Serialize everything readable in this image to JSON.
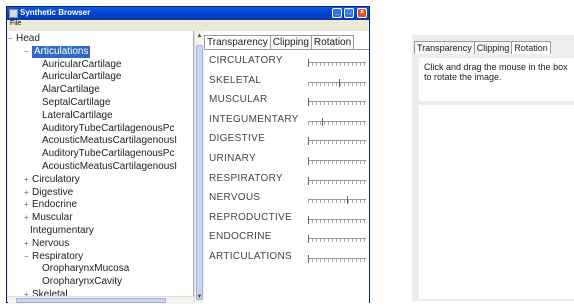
{
  "window": {
    "title": "Synthetic Browser",
    "menu": {
      "file": "File"
    }
  },
  "tree": {
    "nodes": [
      {
        "label": "Head",
        "expander": "−",
        "level": 0
      },
      {
        "label": "Articulations",
        "expander": "−",
        "level": 1,
        "selected": true
      },
      {
        "label": "AuricularCartilage",
        "level": 2
      },
      {
        "label": "AuricularCartilage",
        "level": 2
      },
      {
        "label": "AlarCartilage",
        "level": 2
      },
      {
        "label": "SeptalCartilage",
        "level": 2
      },
      {
        "label": "LateralCartilage",
        "level": 2
      },
      {
        "label": "AuditoryTubeCartilagenousPc",
        "level": 2
      },
      {
        "label": "AcousticMeatusCartilagenousI",
        "level": 2
      },
      {
        "label": "AuditoryTubeCartilagenousPc",
        "level": 2
      },
      {
        "label": "AcousticMeatusCartilagenousI",
        "level": 2
      },
      {
        "label": "Circulatory",
        "expander": "+",
        "level": 1
      },
      {
        "label": "Digestive",
        "expander": "+",
        "level": 1
      },
      {
        "label": "Endocrine",
        "expander": "+",
        "level": 1
      },
      {
        "label": "Muscular",
        "expander": "+",
        "level": 1
      },
      {
        "label": "Integumentary",
        "level": 1
      },
      {
        "label": "Nervous",
        "expander": "+",
        "level": 1
      },
      {
        "label": "Respiratory",
        "expander": "−",
        "level": 1
      },
      {
        "label": "OropharynxMucosa",
        "level": 2
      },
      {
        "label": "OropharynxCavity",
        "level": 2
      },
      {
        "label": "Skeletal",
        "expander": "+",
        "level": 1
      }
    ]
  },
  "tabs": [
    "Transparency",
    "Clipping",
    "Rotation"
  ],
  "active_tab": "Transparency",
  "transparency": [
    {
      "label": "CIRCULATORY",
      "value": 0.0
    },
    {
      "label": "SKELETAL",
      "value": 0.55
    },
    {
      "label": "MUSCULAR",
      "value": 0.0
    },
    {
      "label": "INTEGUMENTARY",
      "value": 0.25
    },
    {
      "label": "DIGESTIVE",
      "value": 0.0
    },
    {
      "label": "URINARY",
      "value": 0.0
    },
    {
      "label": "RESPIRATORY",
      "value": 0.0
    },
    {
      "label": "NERVOUS",
      "value": 0.7
    },
    {
      "label": "REPRODUCTIVE",
      "value": 0.0
    },
    {
      "label": "ENDOCRINE",
      "value": 0.0
    },
    {
      "label": "ARTICULATIONS",
      "value": 0.0
    }
  ],
  "panel2": {
    "tabs": [
      "Transparency",
      "Clipping",
      "Rotation"
    ],
    "active_tab": "Rotation",
    "instruction": "Click and drag the mouse in the box to rotate the image."
  }
}
